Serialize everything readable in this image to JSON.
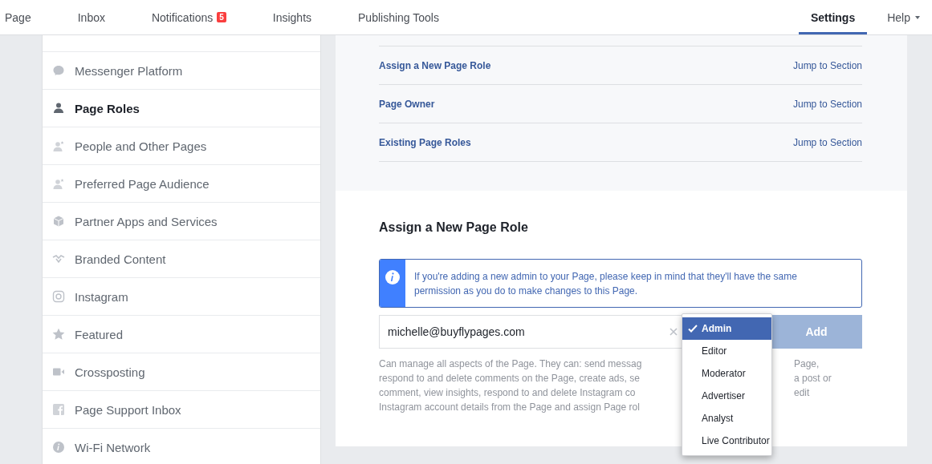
{
  "nav": {
    "left_tabs": [
      {
        "label": "Page",
        "selected": false
      },
      {
        "label": "Inbox",
        "selected": false
      },
      {
        "label": "Notifications",
        "selected": false,
        "badge": "5"
      },
      {
        "label": "Insights",
        "selected": false
      },
      {
        "label": "Publishing Tools",
        "selected": false
      }
    ],
    "right_tabs": [
      {
        "label": "Settings",
        "selected": true,
        "kind": "tab"
      },
      {
        "label": "Help",
        "selected": false,
        "kind": "dropdown"
      }
    ]
  },
  "sidebar": {
    "items": [
      {
        "label": "Messenger Platform",
        "selected": false
      },
      {
        "label": "Page Roles",
        "selected": true
      },
      {
        "label": "People and Other Pages",
        "selected": false
      },
      {
        "label": "Preferred Page Audience",
        "selected": false
      },
      {
        "label": "Partner Apps and Services",
        "selected": false
      },
      {
        "label": "Branded Content",
        "selected": false
      },
      {
        "label": "Instagram",
        "selected": false
      },
      {
        "label": "Featured",
        "selected": false
      },
      {
        "label": "Crossposting",
        "selected": false
      },
      {
        "label": "Page Support Inbox",
        "selected": false
      },
      {
        "label": "Wi-Fi Network",
        "selected": false
      }
    ]
  },
  "sections_index": [
    {
      "title": "Assign a New Page Role",
      "action": "Jump to Section"
    },
    {
      "title": "Page Owner",
      "action": "Jump to Section"
    },
    {
      "title": "Existing Page Roles",
      "action": "Jump to Section"
    }
  ],
  "assign": {
    "heading": "Assign a New Page Role",
    "notice": "If you're adding a new admin to your Page, please keep in mind that they'll have the same permission as you do to make changes to this Page.",
    "email": {
      "value": "michelle@buyflypages.com"
    },
    "button": "Add",
    "description_lines": [
      {
        "left": "Can manage all aspects of the Page. They can: send messag",
        "right": "Page,"
      },
      {
        "left": "respond to and delete comments on the Page, create ads, se",
        "right": "a post or"
      },
      {
        "left": "comment, view insights, respond to and delete Instagram co",
        "right": "edit"
      },
      {
        "left": "Instagram account details from the Page and assign Page rol"
      }
    ],
    "role_options": [
      {
        "label": "Admin",
        "selected": true
      },
      {
        "label": "Editor",
        "selected": false
      },
      {
        "label": "Moderator",
        "selected": false
      },
      {
        "label": "Advertiser",
        "selected": false
      },
      {
        "label": "Analyst",
        "selected": false
      },
      {
        "label": "Live Contributor",
        "selected": false
      }
    ]
  }
}
